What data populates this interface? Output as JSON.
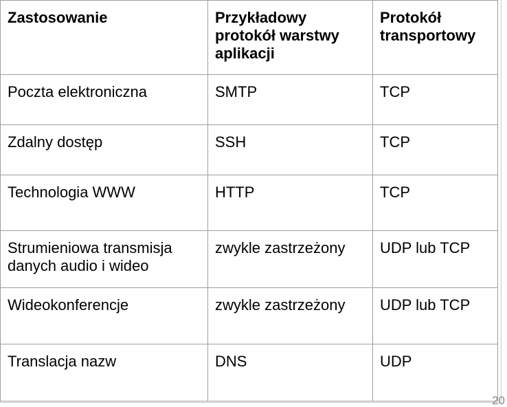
{
  "table": {
    "headers": [
      "Zastosowanie",
      "Przykładowy protokół warstwy aplikacji",
      "Protokół transportowy"
    ],
    "rows": [
      [
        "Poczta elektroniczna",
        "SMTP",
        "TCP"
      ],
      [
        "Zdalny dostęp",
        "SSH",
        "TCP"
      ],
      [
        "Technologia WWW",
        "HTTP",
        "TCP"
      ],
      [
        "Strumieniowa transmisja danych audio i wideo",
        "zwykle zastrzeżony",
        "UDP lub TCP"
      ],
      [
        "Wideokonferencje",
        "zwykle zastrzeżony",
        "UDP lub TCP"
      ],
      [
        "Translacja nazw",
        "DNS",
        "UDP"
      ]
    ]
  },
  "page_number": "20"
}
